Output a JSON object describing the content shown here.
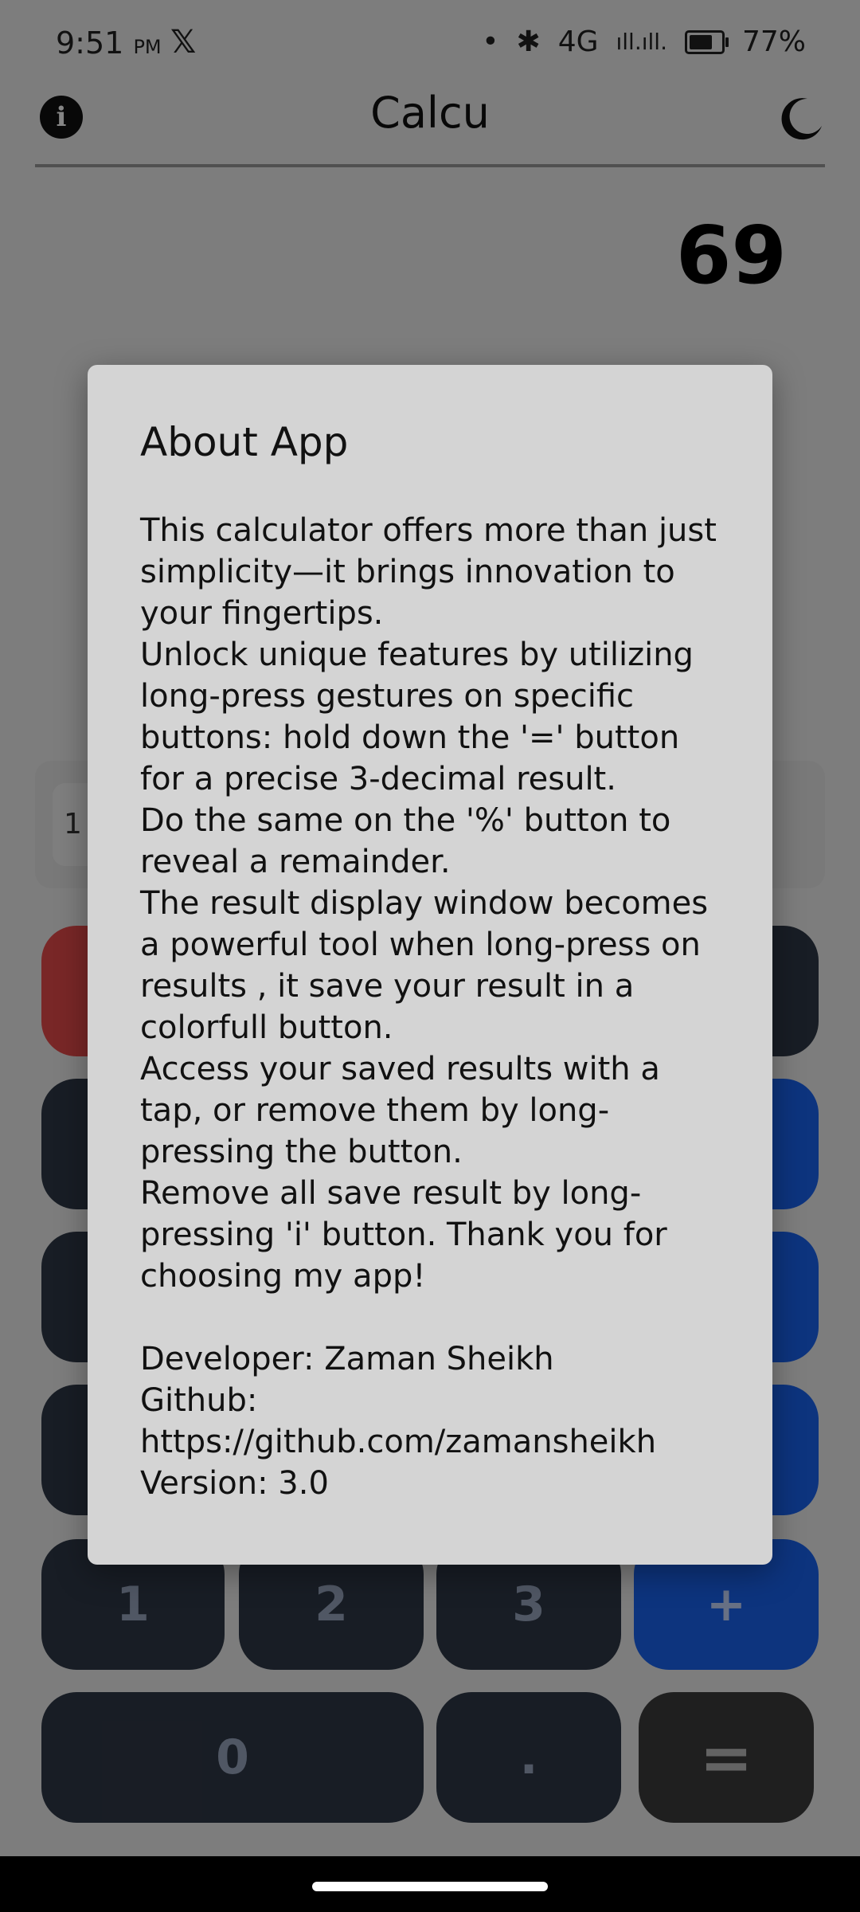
{
  "status_bar": {
    "time": "9:51",
    "ampm": "PM",
    "x_glyph": "𝕏",
    "dot": "•",
    "bluetooth_glyph": "✱",
    "network": "4G",
    "signal": "ıll.ıll.",
    "battery": "77%"
  },
  "header": {
    "info_label": "i",
    "title": "Calcu"
  },
  "display": {
    "value": "69"
  },
  "saved": {
    "chip_label": "1 :"
  },
  "keypad": {
    "one": "1",
    "two": "2",
    "three": "3",
    "plus": "+",
    "zero": "0",
    "dot": ".",
    "equals": "="
  },
  "dialog": {
    "title": "About App",
    "paragraphs": [
      "This calculator offers more than just simplicity—it brings innovation to your fingertips.",
      "Unlock unique features by utilizing long-press gestures on specific buttons: hold down the '=' button for a precise 3-decimal result.",
      "Do the same on the '%' button to reveal a remainder.",
      "The result display window becomes a powerful tool when long-press on results , it save your result in a colorfull button.",
      "Access your saved results with a tap, or remove them by long-pressing the button.",
      "Remove all save result by long-pressing 'i' button. Thank you for choosing my app!"
    ],
    "developer": "Developer: Zaman Sheikh",
    "github": "Github: https://github.com/zamansheikh",
    "version": "Version: 3.0"
  },
  "colors": {
    "blue_key": "#1a64f2",
    "red_key": "#e84c4c",
    "dark_key": "#2f3847",
    "dialog_bg": "#d4d4d4"
  }
}
